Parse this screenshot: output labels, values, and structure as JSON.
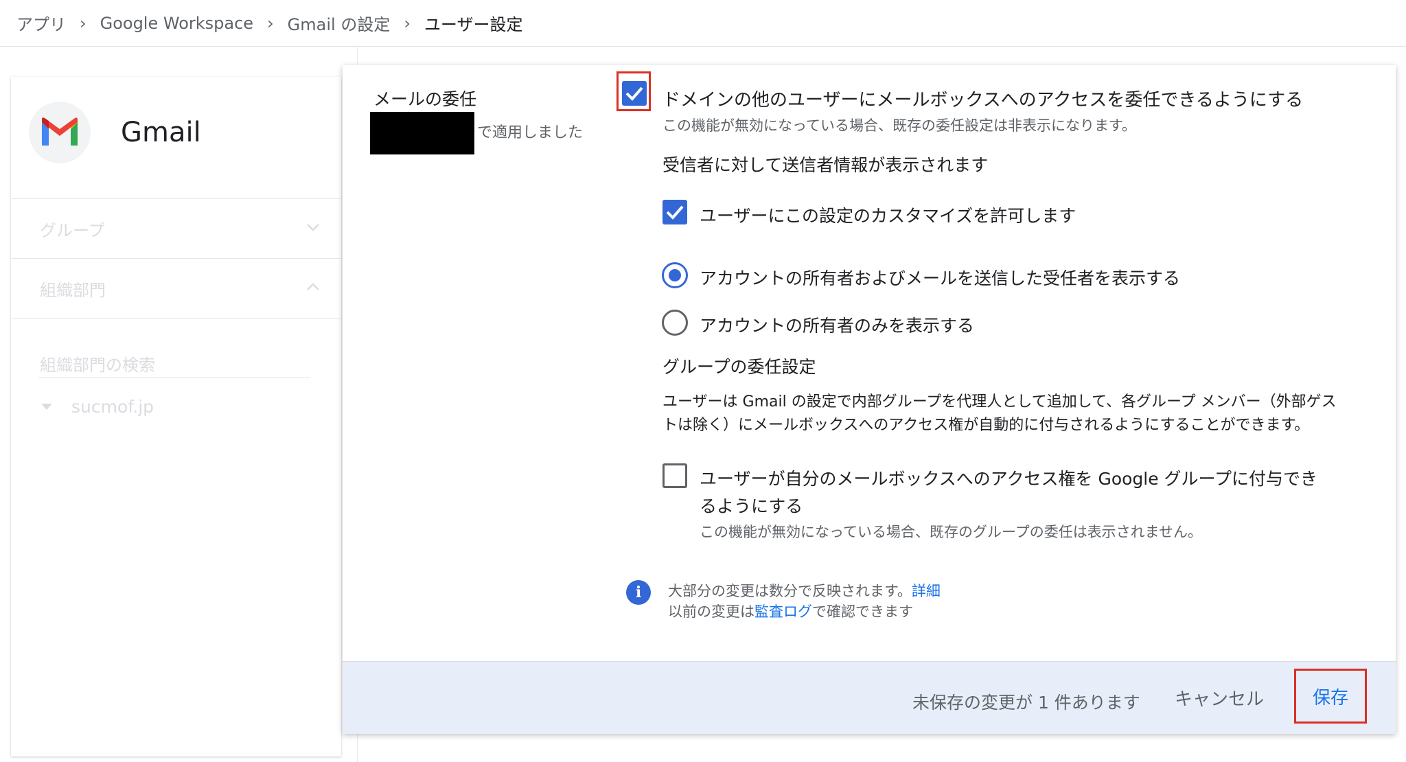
{
  "breadcrumb": {
    "items": [
      "アプリ",
      "Google Workspace",
      "Gmail の設定"
    ],
    "current": "ユーザー設定",
    "separator": "›"
  },
  "sidebar": {
    "app_name": "Gmail",
    "groups_label": "グループ",
    "org_units_label": "組織部門",
    "search_placeholder": "組織部門の検索",
    "org_root": "sucmof.jp"
  },
  "section": {
    "title": "メールの委任",
    "applied_suffix": "で適用しました"
  },
  "settings": {
    "delegation_enable_label": "ドメインの他のユーザーにメールボックスへのアクセスを委任できるようにする",
    "delegation_enable_checked": true,
    "delegation_enable_desc": "この機能が無効になっている場合、既存の委任設定は非表示になります。",
    "sender_info_heading": "受信者に対して送信者情報が表示されます",
    "allow_customize_label": "ユーザーにこの設定のカスタマイズを許可します",
    "allow_customize_checked": true,
    "radio_owner_and_delegate": "アカウントの所有者およびメールを送信した受任者を表示する",
    "radio_owner_only": "アカウントの所有者のみを表示する",
    "radio_selected": "owner_and_delegate",
    "group_heading": "グループの委任設定",
    "group_desc_line1": "ユーザーは Gmail の設定で内部グループを代理人として追加して、各グループ メンバー（外部ゲス",
    "group_desc_line2": "トは除く）にメールボックスへのアクセス権が自動的に付与されるようにすることができます。",
    "group_grant_label_line1": "ユーザーが自分のメールボックスへのアクセス権を Google グループに付与でき",
    "group_grant_label_line2": "るようにする",
    "group_grant_checked": false,
    "group_grant_desc": "この機能が無効になっている場合、既存のグループの委任は表示されません。"
  },
  "info": {
    "line1": "大部分の変更は数分で反映されます。",
    "line1_link": "詳細",
    "line2_prefix": "以前の変更は",
    "line2_link": "監査ログ",
    "line2_suffix": "で確認できます"
  },
  "footer": {
    "unsaved_text": "未保存の変更が 1 件あります",
    "cancel_label": "キャンセル",
    "save_label": "保存"
  },
  "colors": {
    "accent": "#3367d6",
    "link": "#1a73e8",
    "highlight": "#d93025",
    "footer_bg": "#e8eef9"
  }
}
